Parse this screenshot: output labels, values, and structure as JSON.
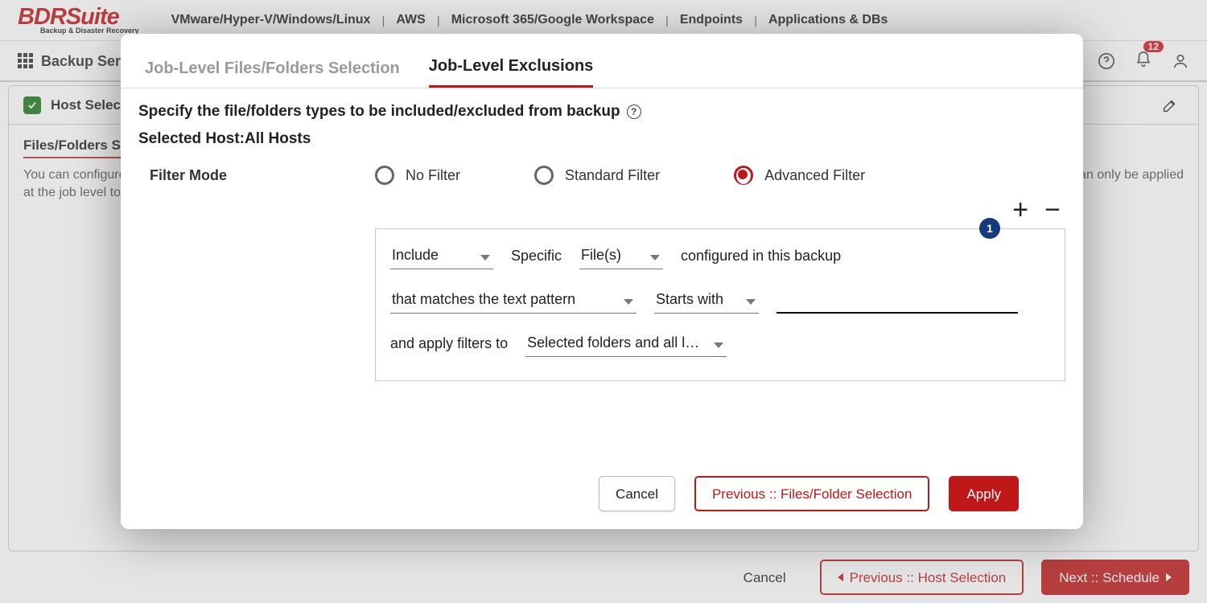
{
  "brand": {
    "name": "BDRSuite",
    "tagline": "Backup & Disaster Recovery"
  },
  "topnav": {
    "items": [
      "VMware/Hyper-V/Windows/Linux",
      "AWS",
      "Microsoft 365/Google Workspace",
      "Endpoints",
      "Applications & DBs"
    ]
  },
  "toolbar": {
    "title": "Backup Server",
    "notification_count": "12"
  },
  "background_page": {
    "tab_label": "Host Selection",
    "panel_title": "Files/Folders Selection",
    "panel_text_left": "You can configure th",
    "panel_text_right": "can only be applied",
    "panel_text_line2": "at the job level to al",
    "edit_right_label": "t"
  },
  "wizard_footer": {
    "cancel": "Cancel",
    "prev": "Previous :: Host Selection",
    "next": "Next :: Schedule"
  },
  "modal": {
    "tabs": {
      "files": "Job-Level Files/Folders Selection",
      "excl": "Job-Level Exclusions"
    },
    "subheader": "Specify the file/folders types to be included/excluded from backup",
    "selected_host_label": "Selected Host:",
    "selected_host_value": "All Hosts",
    "filter_mode_label": "Filter Mode",
    "filter_options": {
      "none": "No Filter",
      "standard": "Standard Filter",
      "advanced": "Advanced Filter"
    },
    "rule_index": "1",
    "rule": {
      "include_exclude": "Include",
      "specific_label": "Specific",
      "target_type": "File(s)",
      "configured_label": "configured in this backup",
      "match_mode": "that matches the text pattern",
      "match_op": "Starts with",
      "pattern_value": "",
      "apply_label": "and apply filters to",
      "apply_scope": "Selected folders and all levels o…"
    },
    "actions": {
      "cancel": "Cancel",
      "prev": "Previous :: Files/Folder Selection",
      "apply": "Apply"
    }
  }
}
